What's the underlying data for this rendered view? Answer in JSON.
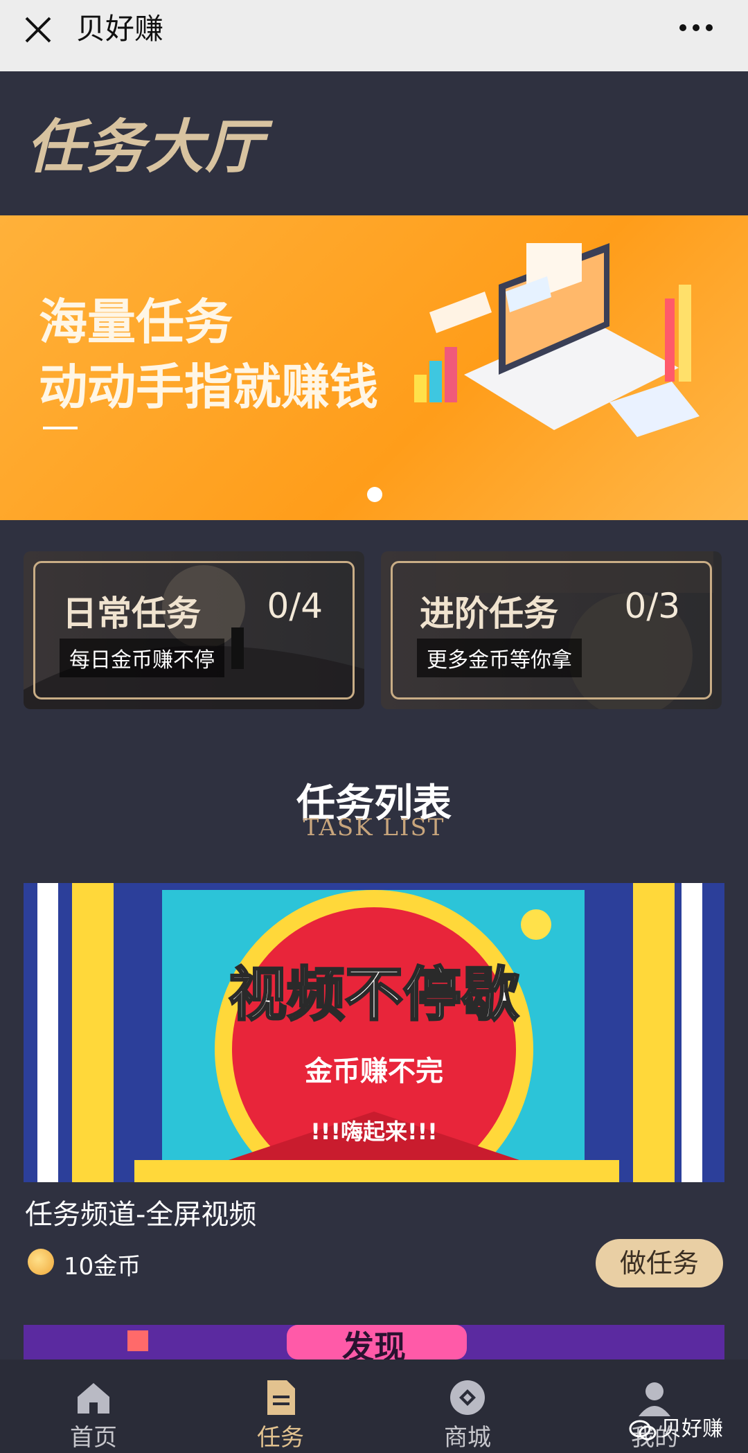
{
  "topbar": {
    "title": "贝好赚",
    "close_icon": "close-icon",
    "more_icon": "more-icon"
  },
  "header": {
    "title": "任务大厅"
  },
  "banner": {
    "line1": "海量任务",
    "line2": "动动手指就赚钱"
  },
  "cards": [
    {
      "name": "日常任务",
      "count": "0/4",
      "subtitle": "每日金币赚不停"
    },
    {
      "name": "进阶任务",
      "count": "0/3",
      "subtitle": "更多金币等你拿"
    }
  ],
  "section": {
    "title_cn": "任务列表",
    "title_en": "TASK LIST"
  },
  "task": {
    "poster_title": "视频不停歇",
    "poster_sub": "金币赚不完",
    "poster_tag": "!!!嗨起来!!!",
    "name": "任务频道-全屏视频",
    "reward": "10金币",
    "button": "做任务"
  },
  "task2": {
    "poster_title": "发现"
  },
  "nav": [
    {
      "label": "首页",
      "icon": "home-icon"
    },
    {
      "label": "任务",
      "icon": "task-icon",
      "active": true
    },
    {
      "label": "商城",
      "icon": "shop-icon"
    },
    {
      "label": "我的",
      "icon": "profile-icon"
    }
  ],
  "watermark": "贝好赚",
  "colors": {
    "background": "#2f3140",
    "accent": "#e9cfa4",
    "banner": "#ffa52a",
    "gold": "#c9ad86"
  }
}
